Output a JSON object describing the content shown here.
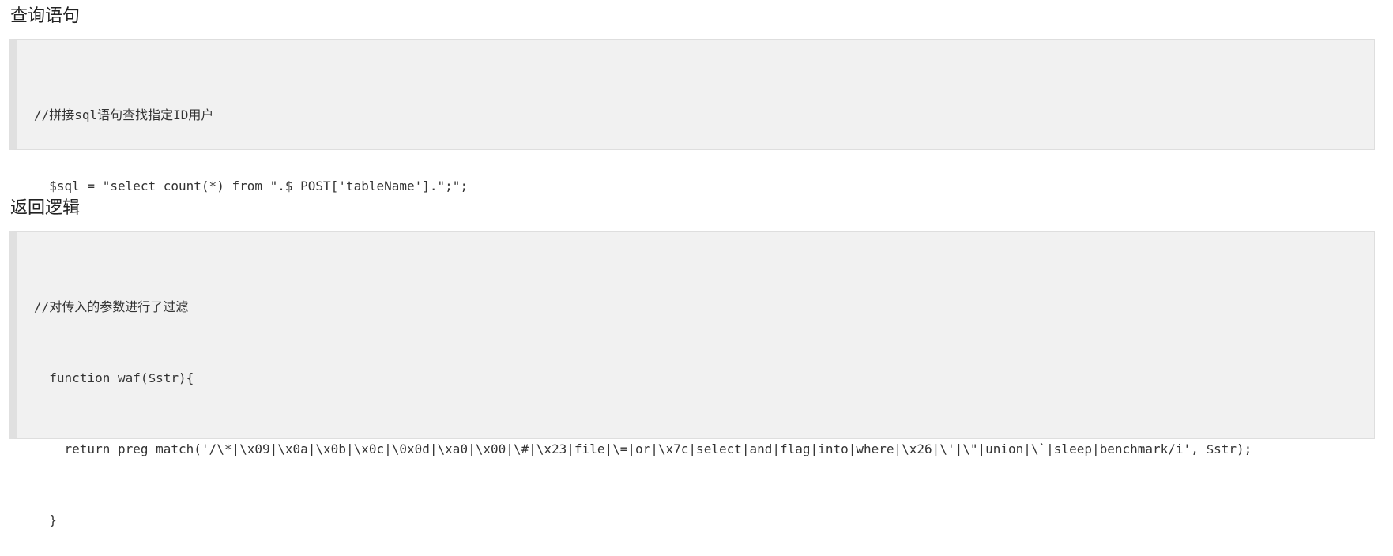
{
  "sections": [
    {
      "title": "查询语句",
      "code_lines": [
        "//拼接sql语句查找指定ID用户",
        "  $sql = \"select count(*) from \".$_POST['tableName'].\";\";"
      ]
    },
    {
      "title": "返回逻辑",
      "code_lines": [
        "//对传入的参数进行了过滤",
        "  function waf($str){",
        "    return preg_match('/\\*|\\x09|\\x0a|\\x0b|\\x0c|\\0x0d|\\xa0|\\x00|\\#|\\x23|file|\\=|or|\\x7c|select|and|flag|into|where|\\x26|\\'|\\\"|union|\\`|sleep|benchmark/i', $str);",
        "  }"
      ]
    }
  ],
  "colors": {
    "code_background": "#f1f1f1",
    "code_left_bar": "#e0e0e0",
    "code_border": "#dedede",
    "text": "#333333"
  }
}
